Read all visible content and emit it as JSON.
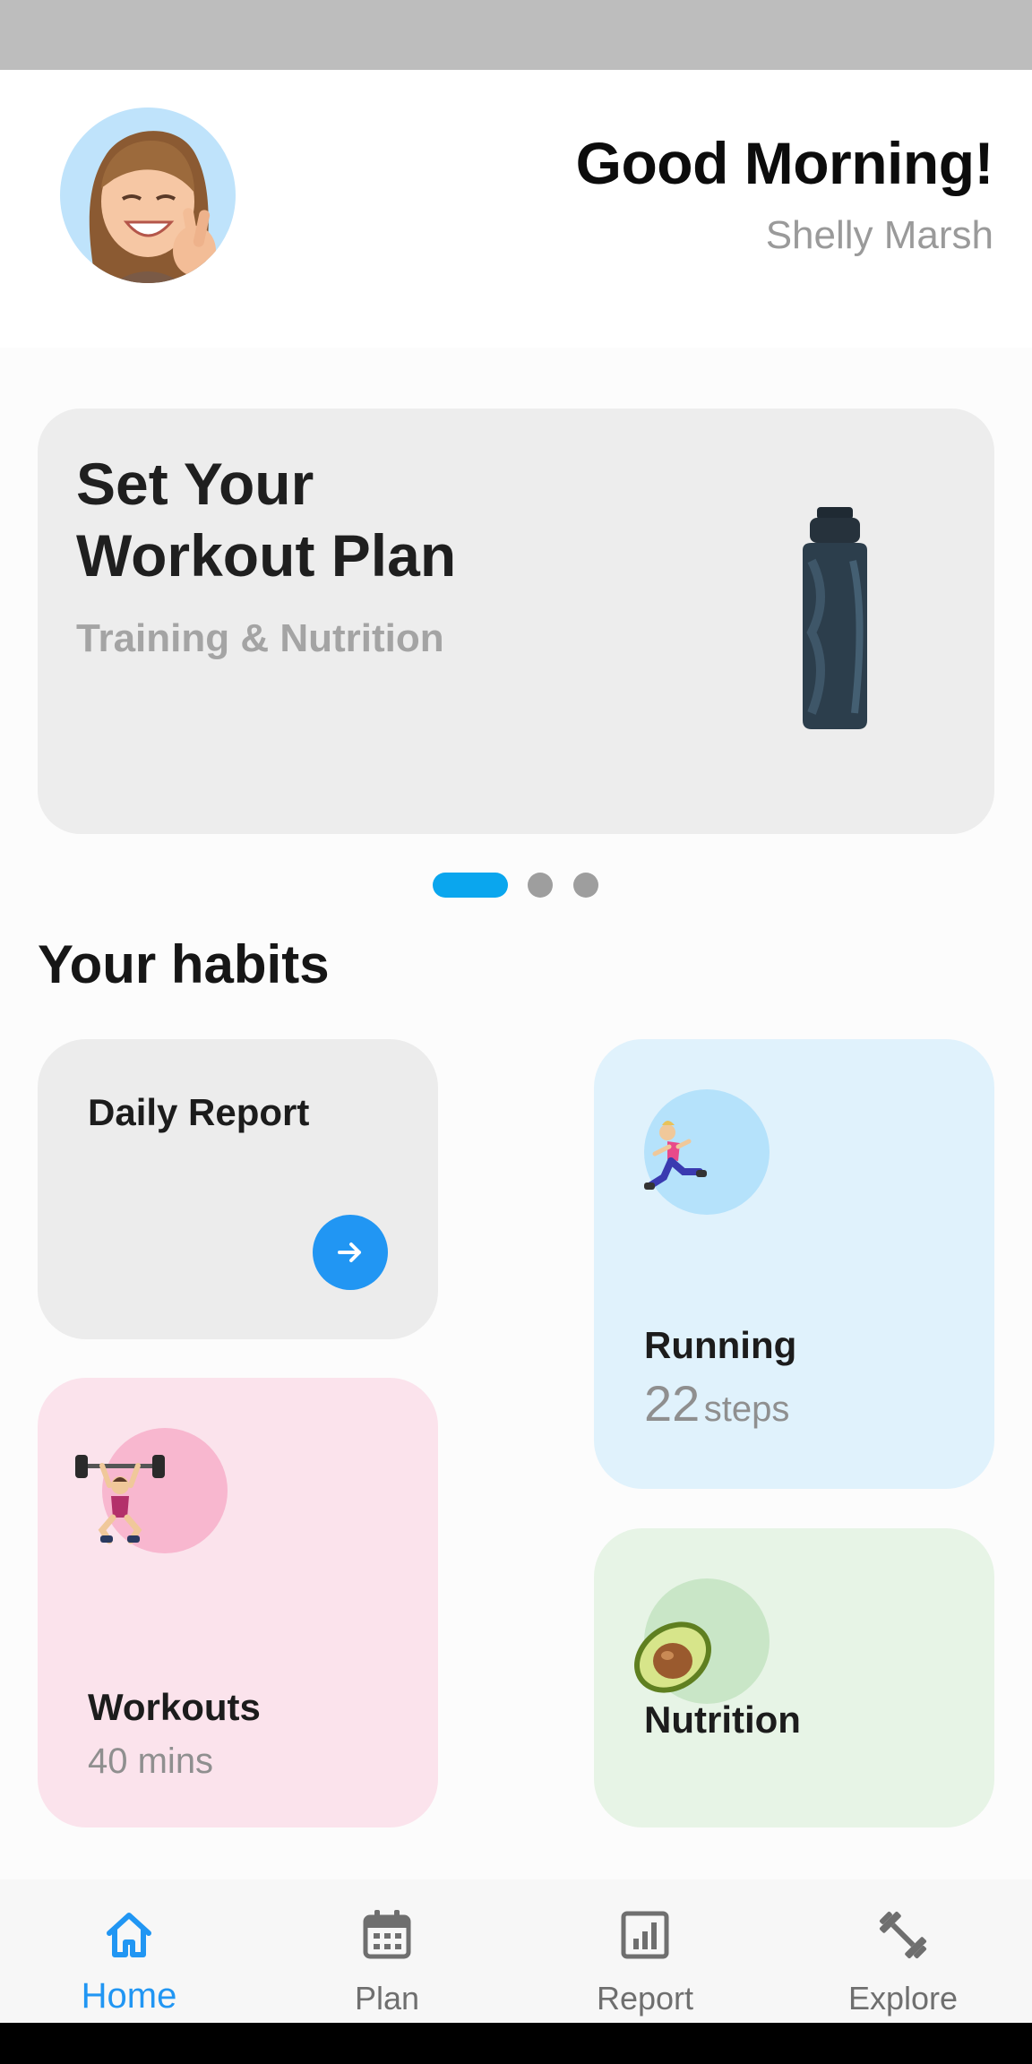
{
  "header": {
    "greeting": "Good Morning!",
    "username": "Shelly Marsh",
    "avatar_icon": "memoji-avatar"
  },
  "banner": {
    "title_line1": "Set Your",
    "title_line2": "Workout Plan",
    "subtitle": "Training & Nutrition",
    "image_icon": "water-bottle",
    "pages": 3,
    "active_page": 1
  },
  "habits": {
    "title": "Your habits",
    "daily_report": {
      "title": "Daily Report",
      "action_icon": "arrow-right-icon"
    },
    "running": {
      "title": "Running",
      "value": "22",
      "unit": "steps",
      "icon": "runner-icon"
    },
    "workouts": {
      "title": "Workouts",
      "value": "40 mins",
      "icon": "weightlifter-icon"
    },
    "nutrition": {
      "title": "Nutrition",
      "icon": "avocado-icon"
    }
  },
  "nav": {
    "items": [
      {
        "label": "Home",
        "icon": "home-icon",
        "active": true
      },
      {
        "label": "Plan",
        "icon": "calendar-icon",
        "active": false
      },
      {
        "label": "Report",
        "icon": "chart-icon",
        "active": false
      },
      {
        "label": "Explore",
        "icon": "dumbbell-icon",
        "active": false
      }
    ]
  },
  "colors": {
    "accent": "#2196f3",
    "indicator": "#0aa6ee",
    "running_card": "#e0f2fc",
    "workouts_card": "#fbe3ec",
    "nutrition_card": "#e7f4e6",
    "neutral_card": "#ececec"
  }
}
